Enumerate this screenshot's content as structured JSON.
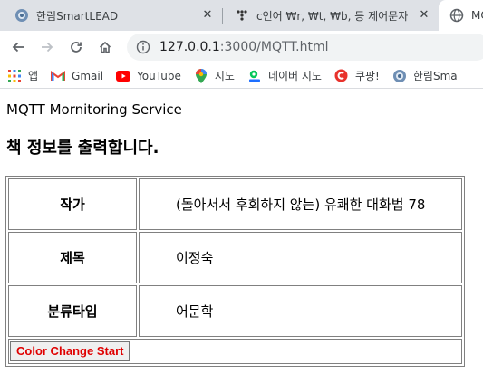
{
  "browser": {
    "tabs": [
      {
        "title": "한림SmartLEAD",
        "icon": "globe-logo-icon"
      },
      {
        "title": "c언어 ₩r, ₩t, ₩b, 등 제어문자",
        "icon": "tistory-icon"
      },
      {
        "title": "MQ",
        "icon": "globe-icon",
        "active": true
      }
    ],
    "address": {
      "host": "127.0.0.1",
      "path": ":3000/MQTT.html"
    },
    "bookmarks": [
      {
        "label": "앱",
        "icon": "apps-grid-icon"
      },
      {
        "label": "Gmail",
        "icon": "gmail-icon"
      },
      {
        "label": "YouTube",
        "icon": "youtube-icon"
      },
      {
        "label": "지도",
        "icon": "maps-pin-icon"
      },
      {
        "label": "네이버 지도",
        "icon": "naver-map-icon"
      },
      {
        "label": "쿠팡!",
        "icon": "coupang-icon"
      },
      {
        "label": "한림Sma",
        "icon": "globe-logo-icon"
      }
    ]
  },
  "page": {
    "service_title": "MQTT Mornitoring Service",
    "heading": "책 정보를 출력합니다.",
    "rows": [
      {
        "key": "작가",
        "value": "(돌아서서 후회하지 않는) 유쾌한 대화법 78"
      },
      {
        "key": "제목",
        "value": "이정숙"
      },
      {
        "key": "분류타입",
        "value": "어문학"
      }
    ],
    "button_label": "Color Change Start",
    "button_text_color": "#e00000"
  }
}
